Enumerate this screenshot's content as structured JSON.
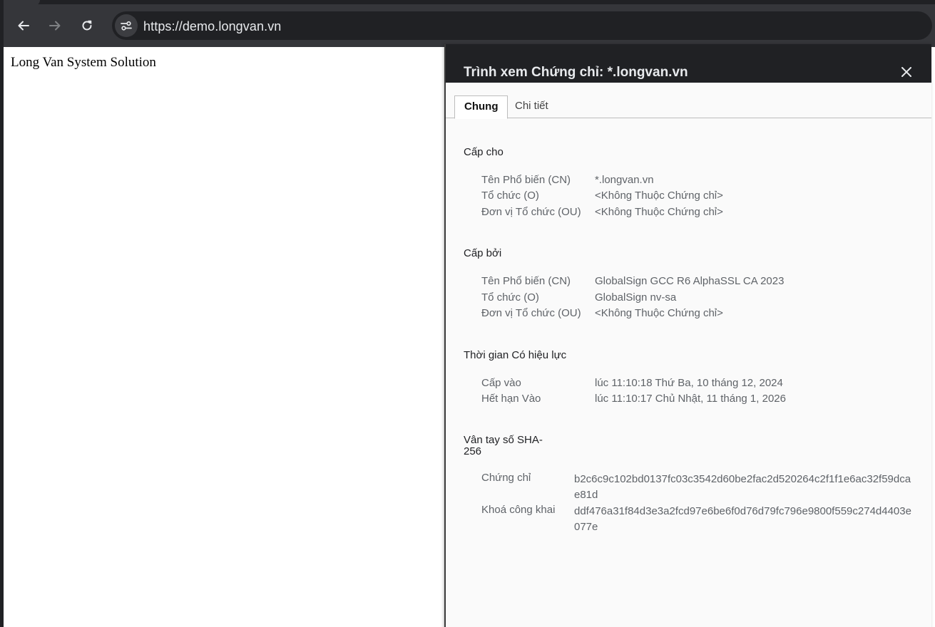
{
  "browser": {
    "url": "https://demo.longvan.vn"
  },
  "page": {
    "heading": "Long Van System Solution"
  },
  "dialog": {
    "title": "Trình xem Chứng chỉ: *.longvan.vn",
    "tabs": [
      {
        "label": "Chung",
        "active": true
      },
      {
        "label": "Chi tiết",
        "active": false
      }
    ],
    "issued_to": {
      "title": "Cấp cho",
      "rows": [
        {
          "label": "Tên Phổ biến (CN)",
          "value": "*.longvan.vn"
        },
        {
          "label": "Tổ chức (O)",
          "value": "<Không Thuộc Chứng chỉ>"
        },
        {
          "label": "Đơn vị Tổ chức (OU)",
          "value": "<Không Thuộc Chứng chỉ>"
        }
      ]
    },
    "issued_by": {
      "title": "Cấp bởi",
      "rows": [
        {
          "label": "Tên Phổ biến (CN)",
          "value": "GlobalSign GCC R6 AlphaSSL CA 2023"
        },
        {
          "label": "Tổ chức (O)",
          "value": "GlobalSign nv-sa"
        },
        {
          "label": "Đơn vị Tổ chức (OU)",
          "value": "<Không Thuộc Chứng chỉ>"
        }
      ]
    },
    "validity": {
      "title": "Thời gian Có hiệu lực",
      "rows": [
        {
          "label": "Cấp vào",
          "value": "lúc 11:10:18 Thứ Ba, 10 tháng 12, 2024"
        },
        {
          "label": "Hết hạn Vào",
          "value": "lúc 11:10:17 Chủ Nhật, 11 tháng 1, 2026"
        }
      ]
    },
    "fingerprints": {
      "title_line1": "Vân tay số SHA-",
      "title_line2": "256",
      "rows": [
        {
          "label": "Chứng chỉ",
          "value": "b2c6c9c102bd0137fc03c3542d60be2fac2d520264c2f1f1e6ac32f59dcae81d"
        },
        {
          "label": "Khoá công khai",
          "value": "ddf476a31f84d3e3a2fcd97e6be6f0d76d79fc796e9800f559c274d4403e077e"
        }
      ]
    }
  },
  "icons": {
    "back": "arrow-left-icon",
    "forward": "arrow-right-icon",
    "reload": "reload-icon",
    "site_info": "tune-icon",
    "close": "close-icon"
  },
  "colors": {
    "chrome_bg": "#35363a",
    "omnibox_bg": "#202124",
    "dialog_header": "#202124",
    "dialog_bg": "#fafafa"
  }
}
